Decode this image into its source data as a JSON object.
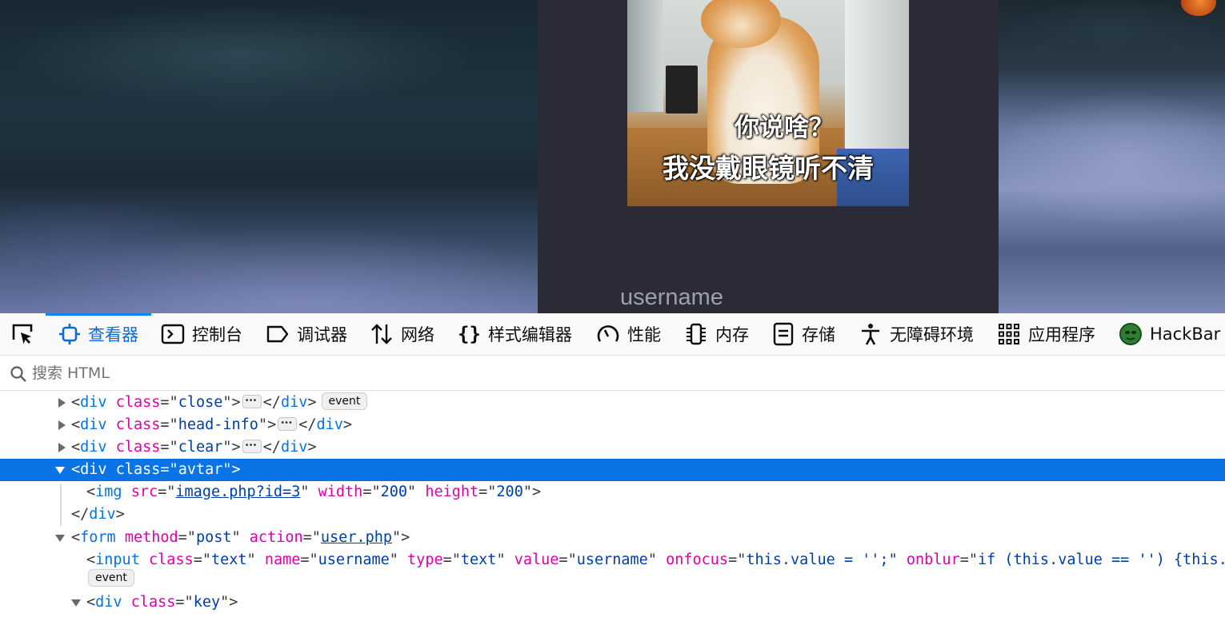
{
  "page": {
    "meme_line1": "你说啥？",
    "meme_line2": "我没戴眼镜听不清",
    "username_placeholder": "username"
  },
  "devtools": {
    "tabs": [
      {
        "label": "查看器",
        "icon": "inspector-icon",
        "active": true
      },
      {
        "label": "控制台",
        "icon": "console-icon"
      },
      {
        "label": "调试器",
        "icon": "debugger-icon"
      },
      {
        "label": "网络",
        "icon": "network-icon"
      },
      {
        "label": "样式编辑器",
        "icon": "style-editor-icon"
      },
      {
        "label": "性能",
        "icon": "performance-icon"
      },
      {
        "label": "内存",
        "icon": "memory-icon"
      },
      {
        "label": "存储",
        "icon": "storage-icon"
      },
      {
        "label": "无障碍环境",
        "icon": "accessibility-icon"
      },
      {
        "label": "应用程序",
        "icon": "application-icon"
      },
      {
        "label": "HackBar",
        "icon": "hackbar-icon"
      }
    ],
    "search_placeholder": "搜索 HTML",
    "accent_color": "#0a84ff",
    "tree": {
      "r1": {
        "tag": "div",
        "attr": "class",
        "val": "close",
        "close": "div",
        "badge": "event"
      },
      "r2": {
        "tag": "div",
        "attr": "class",
        "val": "head-info",
        "close": "div"
      },
      "r3": {
        "tag": "div",
        "attr": "class",
        "val": "clear",
        "close": "div"
      },
      "r4": {
        "tag": "div",
        "attr": "class",
        "val": "avtar"
      },
      "r5": {
        "tag": "img",
        "a1": "src",
        "v1": "image.php?id=3",
        "a2": "width",
        "v2": "200",
        "a3": "height",
        "v3": "200"
      },
      "r6": {
        "close": "div"
      },
      "r7": {
        "tag": "form",
        "a1": "method",
        "v1": "post",
        "a2": "action",
        "v2": "user.php"
      },
      "r8": {
        "tag": "input",
        "a1": "class",
        "v1": "text",
        "a2": "name",
        "v2": "username",
        "a3": "type",
        "v3": "text",
        "a4": "value",
        "v4": "username",
        "a5": "onfocus",
        "v5": "this.value = '';",
        "a6": "onblur",
        "v6": "if (this.value == '') {this.value"
      },
      "r8b": {
        "badge": "event"
      },
      "r9": {
        "tag": "div",
        "attr": "class",
        "val": "key"
      }
    }
  }
}
